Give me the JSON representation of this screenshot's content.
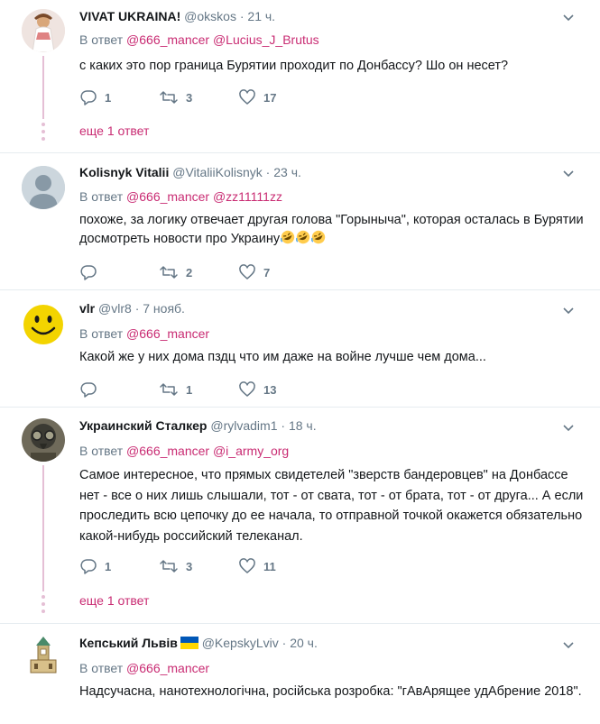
{
  "reply_to_prefix": "В ответ",
  "tweets": [
    {
      "name": "VIVAT UKRAINA!",
      "handle": "@okskos",
      "sep": "·",
      "time": "21 ч.",
      "mentions": [
        "@666_mancer",
        "@Lucius_J_Brutus"
      ],
      "text": "с каких это пор граница Бурятии проходит по Донбассу? Шо он несет?",
      "replies": "1",
      "retweets": "3",
      "likes": "17",
      "more": "еще 1 ответ"
    },
    {
      "name": "Kolisnyk Vitalii",
      "handle": "@VitaliiKolisnyk",
      "sep": "·",
      "time": "23 ч.",
      "mentions": [
        "@666_mancer",
        "@zz11111zz"
      ],
      "text": "похоже, за логику отвечает другая голова \"Горыныча\", которая осталась в Бурятии досмотреть новости про Украину",
      "replies": "",
      "retweets": "2",
      "likes": "7"
    },
    {
      "name": "vlr",
      "handle": "@vlr8",
      "sep": "·",
      "time": "7 нояб.",
      "mentions": [
        "@666_mancer"
      ],
      "text": "Какой же у них дома пздц что им даже на войне лучше чем дома...",
      "replies": "",
      "retweets": "1",
      "likes": "13"
    },
    {
      "name": "Украинский Сталкер",
      "handle": "@rylvadim1",
      "sep": "·",
      "time": "18 ч.",
      "mentions": [
        "@666_mancer",
        "@i_army_org"
      ],
      "text": "Самое интересное, что прямых свидетелей \"зверств бандеровцев\" на Донбассе нет - все о них лишь слышали, тот - от свата, тот - от брата, тот - от друга... А если проследить всю цепочку до ее начала, то отправной точкой окажется обязательно какой-нибудь российский телеканал.",
      "replies": "1",
      "retweets": "3",
      "likes": "11",
      "more": "еще 1 ответ"
    },
    {
      "name": "Кепський Львів",
      "handle": "@KepskyLviv",
      "sep": "·",
      "time": "20 ч.",
      "mentions": [
        "@666_mancer"
      ],
      "text": "Надсучасна, нанотехнологічна, російська розробка: \"гАвАрящее удАбрение 2018\"."
    }
  ],
  "icons": {
    "reply": "reply-icon",
    "retweet": "retweet-icon",
    "like": "heart-icon",
    "menu": "chevron-down-icon",
    "emoji": "rolling-on-floor-laughing-emoji",
    "flag": "ukraine-flag-emoji"
  },
  "colors": {
    "link": "#c92c73",
    "muted": "#657786",
    "thread_line": "#e5bfd5",
    "border": "#e6ecf0"
  }
}
